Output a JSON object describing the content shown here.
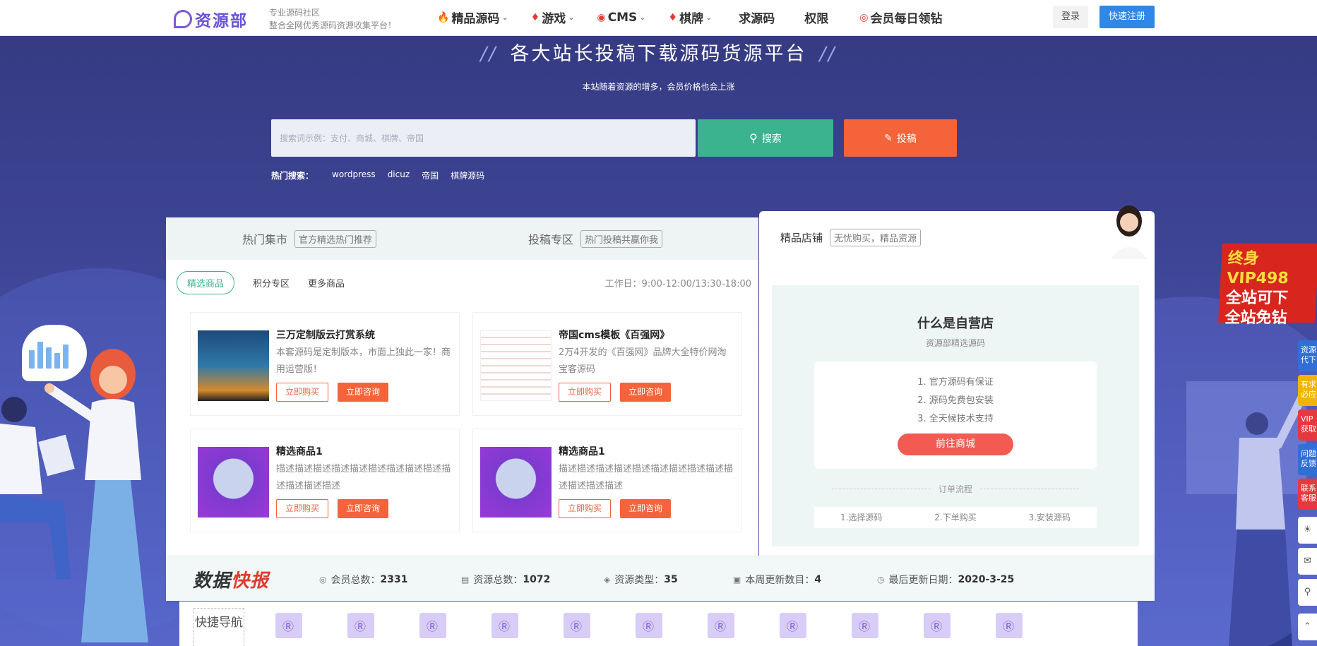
{
  "header": {
    "logo_text": "资源部",
    "slogan_line1": "专业源码社区",
    "slogan_line2": "整合全网优秀源码资源收集平台！",
    "nav": [
      {
        "label": "精品源码",
        "icon": "fire-icon",
        "dropdown": true
      },
      {
        "label": "游戏",
        "icon": "drop-icon",
        "dropdown": true
      },
      {
        "label": "CMS",
        "icon": "cms-icon",
        "dropdown": true
      },
      {
        "label": "棋牌",
        "icon": "drop-icon",
        "dropdown": true
      },
      {
        "label": "求源码",
        "icon": "",
        "dropdown": false
      },
      {
        "label": "权限",
        "icon": "",
        "dropdown": false
      },
      {
        "label": "会员每日领钻",
        "icon": "gift-icon",
        "dropdown": false
      }
    ],
    "login_label": "登录",
    "register_label": "快速注册"
  },
  "hero": {
    "title": "各大站长投稿下载源码货源平台",
    "title_deco": "//",
    "subtitle": "本站随着资源的增多，会员价格也会上涨",
    "search_placeholder": "搜索词示例：支付、商城、棋牌、帝国",
    "search_label": "搜索",
    "post_label": "投稿",
    "hot_label": "热门搜索：",
    "hot_keywords": [
      "wordpress",
      "dicuz",
      "帝国",
      "棋牌源码"
    ]
  },
  "market": {
    "tabs": [
      {
        "label": "热门集市",
        "tag": "官方精选热门推荐"
      },
      {
        "label": "投稿专区",
        "tag": "热门投稿共赢你我"
      }
    ],
    "subtabs": [
      "精选商品",
      "积分专区",
      "更多商品"
    ],
    "worktime": "工作日：9:00-12:00/13:30-18:00",
    "buy_label": "立即购买",
    "ask_label": "立即咨询",
    "products": [
      {
        "title": "三万定制版云打赏系统",
        "desc": "本套源码是定制版本，市面上独此一家！商用运营版！"
      },
      {
        "title": "帝国cms模板《百强网》",
        "desc": "2万4开发的《百强网》品牌大全特价网淘宝客源码"
      },
      {
        "title": "精选商品1",
        "desc": "描述描述描述描述描述描述描述描述描述描述描述描述描述"
      },
      {
        "title": "精选商品1",
        "desc": "描述描述描述描述描述描述描述描述描述描述描述描述描述"
      }
    ]
  },
  "shop": {
    "title": "精品店铺",
    "tag": "无忧购买，精品资源",
    "question": "什么是自营店",
    "question_sub": "资源部精选源码",
    "points": [
      "1. 官方源码有保证",
      "2. 源码免费包安装",
      "3. 全天候技术支持"
    ],
    "go_label": "前往商城",
    "flow_title": "订单流程",
    "flow_steps": [
      "1.选择源码",
      "2.下单购买",
      "3.安装源码"
    ]
  },
  "stats": {
    "logo_a": "数据",
    "logo_b": "快报",
    "items": [
      {
        "label": "会员总数：",
        "value": "2331",
        "icon": "user-icon"
      },
      {
        "label": "资源总数：",
        "value": "1072",
        "icon": "doc-icon"
      },
      {
        "label": "资源类型：",
        "value": "35",
        "icon": "layers-icon"
      },
      {
        "label": "本周更新数目：",
        "value": "4",
        "icon": "calendar-icon"
      },
      {
        "label": "最后更新日期：",
        "value": "2020-3-25",
        "icon": "clock-icon"
      }
    ]
  },
  "quick_nav": {
    "label": "快捷导航"
  },
  "promo": {
    "line1": "终身VIP498",
    "line2": "全站可下",
    "line3": "全站免钻"
  },
  "side_buttons": [
    {
      "label": "资源代下",
      "color": "#2f6fd6"
    },
    {
      "label": "有求必应",
      "color": "#f2b400"
    },
    {
      "label": "VIP获取",
      "color": "#e5393d"
    },
    {
      "label": "问题反馈",
      "color": "#2f6fd6"
    },
    {
      "label": "联系客服",
      "color": "#e5393d"
    }
  ]
}
